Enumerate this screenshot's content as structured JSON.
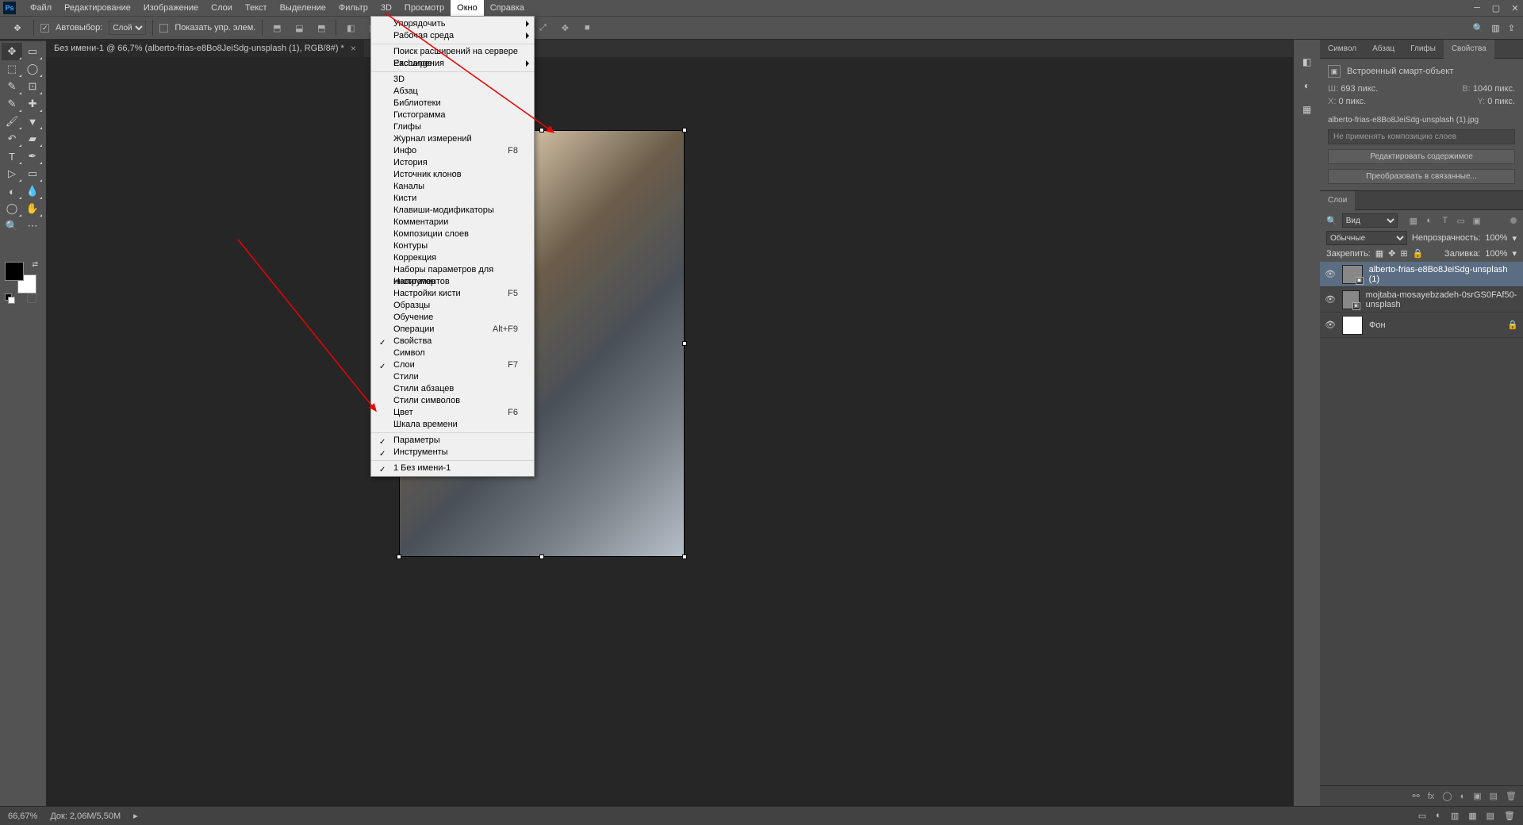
{
  "menubar": {
    "items": [
      "Файл",
      "Редактирование",
      "Изображение",
      "Слои",
      "Текст",
      "Выделение",
      "Фильтр",
      "3D",
      "Просмотр",
      "Окно",
      "Справка"
    ],
    "active_index": 9
  },
  "optionsbar": {
    "autoselect_label": "Автовыбор:",
    "autoselect_dropdown": "Слой",
    "show_transform_label": "Показать упр. элем."
  },
  "document_tab": {
    "title": "Без имени-1 @ 66,7% (alberto-frias-e8Bo8JeiSdg-unsplash (1), RGB/8#) *"
  },
  "window_menu": {
    "groups": [
      {
        "items": [
          {
            "label": "Упорядочить",
            "submenu": true
          },
          {
            "label": "Рабочая среда",
            "submenu": true
          }
        ]
      },
      {
        "items": [
          {
            "label": "Поиск расширений на сервере Exchange..."
          },
          {
            "label": "Расширения",
            "submenu": true
          }
        ]
      },
      {
        "items": [
          {
            "label": "3D"
          },
          {
            "label": "Абзац"
          },
          {
            "label": "Библиотеки"
          },
          {
            "label": "Гистограмма"
          },
          {
            "label": "Глифы"
          },
          {
            "label": "Журнал измерений"
          },
          {
            "label": "Инфо",
            "shortcut": "F8"
          },
          {
            "label": "История"
          },
          {
            "label": "Источник клонов"
          },
          {
            "label": "Каналы"
          },
          {
            "label": "Кисти"
          },
          {
            "label": "Клавиши-модификаторы"
          },
          {
            "label": "Комментарии"
          },
          {
            "label": "Композиции слоев"
          },
          {
            "label": "Контуры"
          },
          {
            "label": "Коррекция"
          },
          {
            "label": "Наборы параметров для инструментов"
          },
          {
            "label": "Навигатор"
          },
          {
            "label": "Настройки кисти",
            "shortcut": "F5"
          },
          {
            "label": "Образцы"
          },
          {
            "label": "Обучение"
          },
          {
            "label": "Операции",
            "shortcut": "Alt+F9"
          },
          {
            "label": "Свойства",
            "checked": true
          },
          {
            "label": "Символ"
          },
          {
            "label": "Слои",
            "checked": true,
            "shortcut": "F7"
          },
          {
            "label": "Стили"
          },
          {
            "label": "Стили абзацев"
          },
          {
            "label": "Стили символов"
          },
          {
            "label": "Цвет",
            "shortcut": "F6"
          },
          {
            "label": "Шкала времени"
          }
        ]
      },
      {
        "items": [
          {
            "label": "Параметры",
            "checked": true
          },
          {
            "label": "Инструменты",
            "checked": true
          }
        ]
      },
      {
        "items": [
          {
            "label": "1 Без имени-1",
            "checked": true
          }
        ]
      }
    ]
  },
  "properties_panel": {
    "tabs": [
      "Символ",
      "Абзац",
      "Глифы",
      "Свойства"
    ],
    "active_tab": 3,
    "header": "Встроенный смарт-объект",
    "w_label": "Ш:",
    "w_value": "693 пикс.",
    "h_label": "В:",
    "h_value": "1040 пикс.",
    "x_label": "X:",
    "x_value": "0 пикс.",
    "y_label": "Y:",
    "y_value": "0 пикс.",
    "filename": "alberto-frias-e8Bo8JeiSdg-unsplash (1).jpg",
    "hint": "Не применять композицию слоев",
    "btn_edit": "Редактировать содержимое",
    "btn_convert": "Преобразовать в связанные..."
  },
  "layers_panel": {
    "tab": "Слои",
    "filter_label": "Вид",
    "blend_mode": "Обычные",
    "opacity_label": "Непрозрачность:",
    "opacity_value": "100%",
    "lock_label": "Закрепить:",
    "fill_label": "Заливка:",
    "fill_value": "100%",
    "layers": [
      {
        "name": "alberto-frias-e8Bo8JeiSdg-unsplash (1)",
        "selected": true,
        "smart": true
      },
      {
        "name": "mojtaba-mosayebzadeh-0srGS0FAf50-unsplash",
        "smart": true
      },
      {
        "name": "Фон",
        "locked": true,
        "white": true
      }
    ]
  },
  "statusbar": {
    "zoom": "66,67%",
    "doc": "Док: 2,06M/5,50M"
  }
}
